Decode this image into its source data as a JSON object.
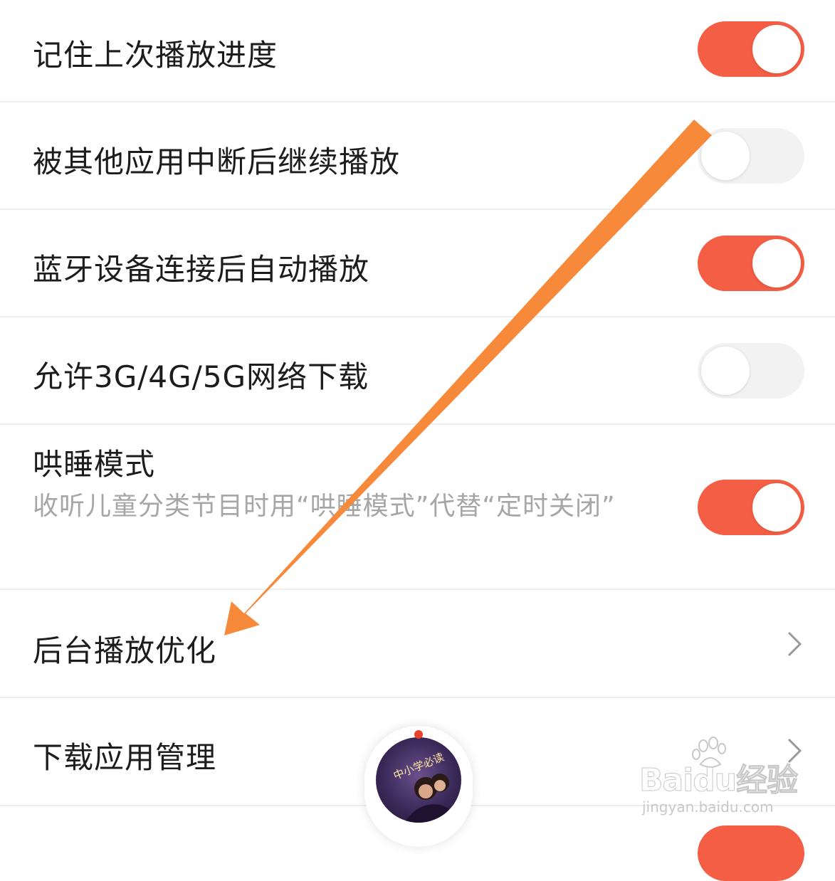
{
  "settings": {
    "remember_progress": {
      "label": "记住上次播放进度",
      "enabled": true
    },
    "resume_after_interrupt": {
      "label": "被其他应用中断后继续播放",
      "enabled": false
    },
    "bluetooth_autoplay": {
      "label": "蓝牙设备连接后自动播放",
      "enabled": true
    },
    "mobile_download": {
      "label": "允许3G/4G/5G网络下载",
      "enabled": false
    },
    "sleep_mode": {
      "label": "哄睡模式",
      "description": "收听儿童分类节目时用“哄睡模式”代替“定时关闭”",
      "enabled": true
    },
    "background_optimize": {
      "label": "后台播放优化"
    },
    "download_app_manage": {
      "label": "下载应用管理"
    }
  },
  "mini_player": {
    "cover_text": "中小学必读"
  },
  "watermark": {
    "brand": "Baidu经验",
    "url": "jingyan.baidu.com"
  },
  "colors": {
    "toggle_on": "#f45e45",
    "toggle_off": "#f2f2f2",
    "annotation_arrow": "#f78a3a"
  },
  "icons": {
    "chevron": "chevron-right-icon",
    "arrow": "annotation-arrow-icon"
  }
}
